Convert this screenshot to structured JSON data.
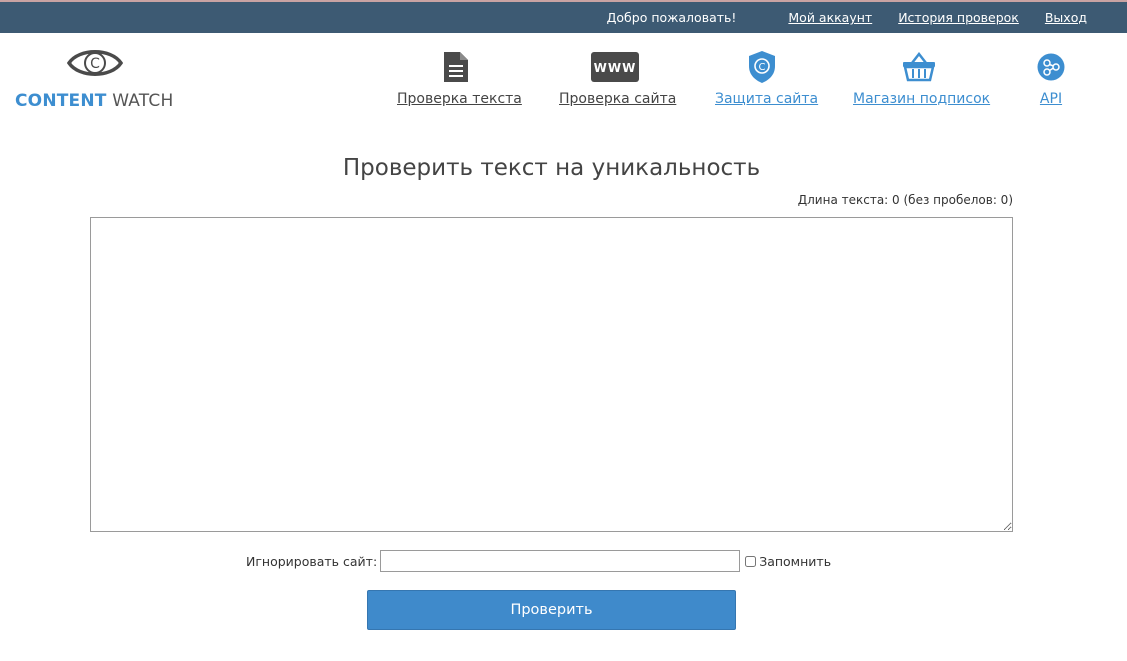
{
  "topbar": {
    "welcome": "Добро пожаловать!",
    "links": [
      "Мой аккаунт",
      "История проверок",
      "Выход"
    ]
  },
  "logo": {
    "part1": "CONTENT",
    "part2": "WATCH"
  },
  "nav": [
    {
      "label": "Проверка текста",
      "icon": "document-icon"
    },
    {
      "label": "Проверка сайта",
      "icon": "www-icon"
    },
    {
      "label": "Защита сайта",
      "icon": "shield-copyright-icon"
    },
    {
      "label": "Магазин подписок",
      "icon": "basket-icon"
    },
    {
      "label": "API",
      "icon": "api-icon"
    }
  ],
  "main": {
    "title": "Проверить текст на уникальность",
    "length_info": "Длина текста: 0 (без пробелов: 0)",
    "text_value": "",
    "ignore_label": "Игнорировать сайт:",
    "ignore_value": "",
    "remember_label": "Запомнить",
    "submit_label": "Проверить"
  },
  "colors": {
    "topbar": "#3d5a73",
    "accent": "#3d8ed0",
    "button": "#3f8acb"
  }
}
